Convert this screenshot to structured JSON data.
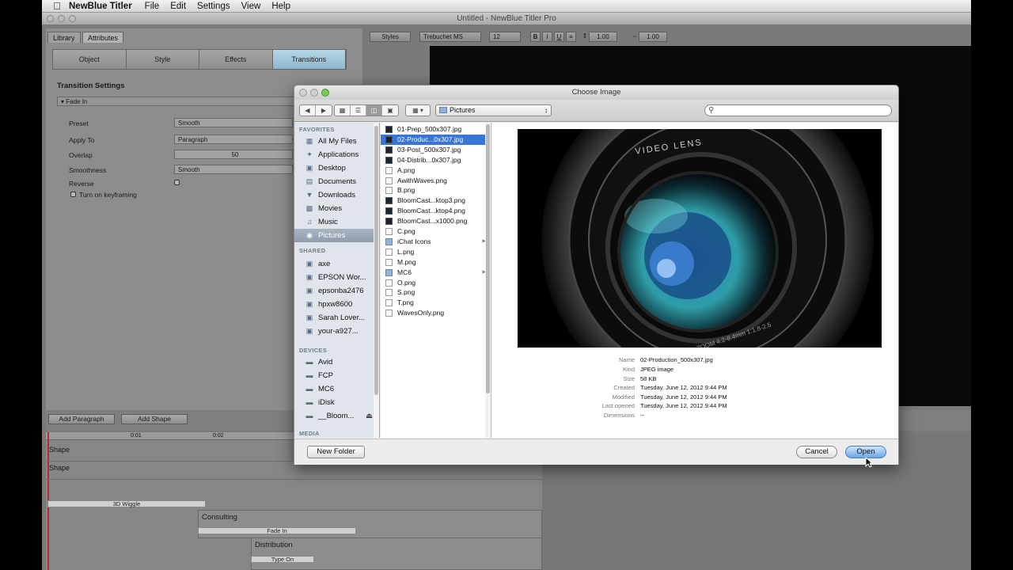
{
  "menubar": {
    "app_name": "NewBlue Titler",
    "items": [
      "File",
      "Edit",
      "Settings",
      "View",
      "Help"
    ]
  },
  "window": {
    "title": "Untitled - NewBlue Titler Pro"
  },
  "left_panel": {
    "tabs": [
      "Library",
      "Attributes"
    ],
    "segments": [
      "Object",
      "Style",
      "Effects",
      "Transitions"
    ],
    "section_title": "Transition Settings",
    "group_title": "Fade In",
    "fields": {
      "preset_label": "Preset",
      "preset_value": "Smooth",
      "apply_to_label": "Apply To",
      "apply_to_value": "Paragraph",
      "overlap_label": "Overlap",
      "overlap_value": "50",
      "smoothness_label": "Smoothness",
      "smoothness_value": "Smooth",
      "reverse_label": "Reverse",
      "keyframing_label": "Turn on keyframing"
    }
  },
  "format_toolbar": {
    "styles": "Styles",
    "font": "Trebuchet MS",
    "size": "12",
    "bold": "B",
    "italic": "I",
    "underline": "U",
    "line_spacing": "1.00",
    "char_spacing": "1.00"
  },
  "bottom_buttons": {
    "add_paragraph": "Add Paragraph",
    "add_shape": "Add Shape"
  },
  "timeline": {
    "ticks": [
      "0:01",
      "0:02"
    ],
    "rows": [
      "Shape",
      "Shape"
    ],
    "clips": [
      "3D Wiggle",
      "Fade In",
      "Type On"
    ],
    "blocks": [
      "Consulting",
      "Distribution"
    ]
  },
  "dialog": {
    "title": "Choose Image",
    "path": "Pictures",
    "search_placeholder": "",
    "sidebar": {
      "favorites_header": "FAVORITES",
      "favorites": [
        "All My Files",
        "Applications",
        "Desktop",
        "Documents",
        "Downloads",
        "Movies",
        "Music",
        "Pictures"
      ],
      "shared_header": "SHARED",
      "shared": [
        "axe",
        "EPSON Wor...",
        "epsonba2476",
        "hpxw8600",
        "Sarah Lover...",
        "your-a927..."
      ],
      "devices_header": "DEVICES",
      "devices": [
        "Avid",
        "FCP",
        "MC6",
        "iDisk",
        "__Bloom..."
      ],
      "media_header": "MEDIA"
    },
    "files": [
      {
        "name": "01-Prep_500x307.jpg",
        "kind": "img"
      },
      {
        "name": "02-Produc...0x307.jpg",
        "kind": "img"
      },
      {
        "name": "03-Post_500x307.jpg",
        "kind": "img"
      },
      {
        "name": "04-Distrib...0x307.jpg",
        "kind": "img"
      },
      {
        "name": "A.png",
        "kind": "file"
      },
      {
        "name": "AwithWaves.png",
        "kind": "file"
      },
      {
        "name": "B.png",
        "kind": "file"
      },
      {
        "name": "BloomCast...ktop3.png",
        "kind": "img"
      },
      {
        "name": "BloomCast...ktop4.png",
        "kind": "img"
      },
      {
        "name": "BloomCast...x1000.png",
        "kind": "img"
      },
      {
        "name": "C.png",
        "kind": "file"
      },
      {
        "name": "iChat Icons",
        "kind": "folder"
      },
      {
        "name": "L.png",
        "kind": "file"
      },
      {
        "name": "M.png",
        "kind": "file"
      },
      {
        "name": "MC6",
        "kind": "folder"
      },
      {
        "name": "O.png",
        "kind": "file"
      },
      {
        "name": "S.png",
        "kind": "file"
      },
      {
        "name": "T.png",
        "kind": "file"
      },
      {
        "name": "WavesOnly.png",
        "kind": "file"
      }
    ],
    "preview_image_text": {
      "top": "VIDEO LENS",
      "bottom": "3x ZOOM 4.2-8.4mm 1:1.8-2.5"
    },
    "info": {
      "name_label": "Name",
      "name": "02-Production_500x307.jpg",
      "kind_label": "Kind",
      "kind": "JPEG image",
      "size_label": "Size",
      "size": "58 KB",
      "created_label": "Created",
      "created": "Tuesday, June 12, 2012 9:44 PM",
      "modified_label": "Modified",
      "modified": "Tuesday, June 12, 2012 9:44 PM",
      "last_opened_label": "Last opened",
      "last_opened": "Tuesday, June 12, 2012 9:44 PM",
      "dimensions_label": "Dimensions",
      "dimensions": "--"
    },
    "buttons": {
      "new_folder": "New Folder",
      "cancel": "Cancel",
      "open": "Open"
    }
  }
}
